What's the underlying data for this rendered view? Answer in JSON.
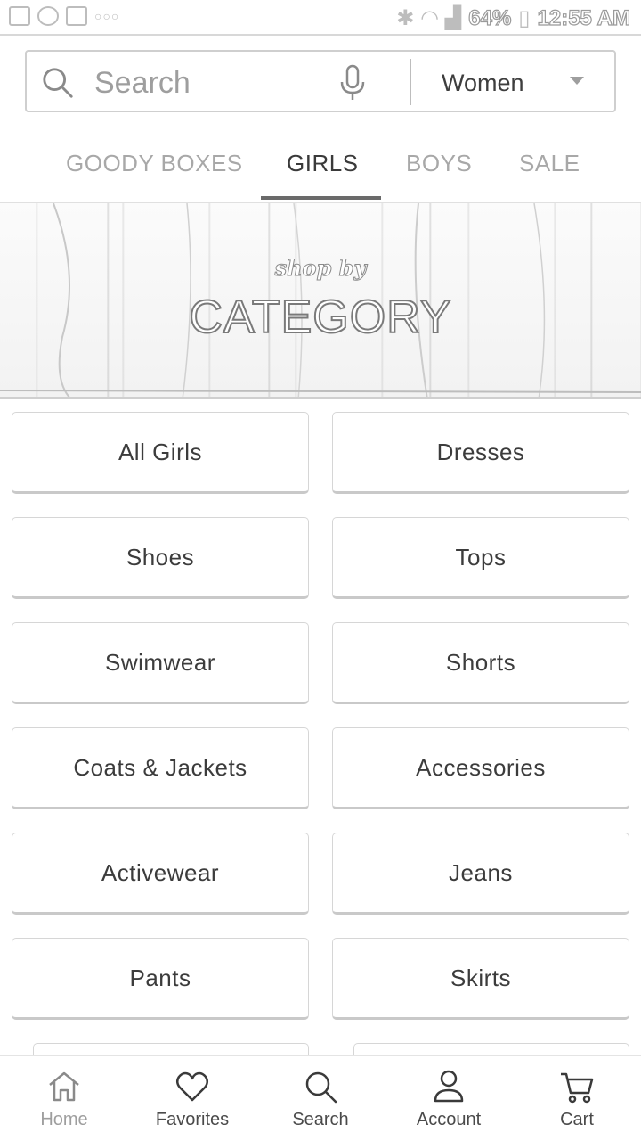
{
  "status_bar": {
    "battery": "64%",
    "time": "12:55 AM",
    "icons": [
      "photo-icon",
      "pinwheel-icon",
      "mail-icon",
      "voicemail-icon",
      "bluetooth-icon",
      "wifi-icon",
      "signal-icon",
      "battery-icon"
    ]
  },
  "search": {
    "placeholder": "Search",
    "department": "Women"
  },
  "tabs": [
    {
      "label": "GOODY BOXES",
      "active": false
    },
    {
      "label": "GIRLS",
      "active": true
    },
    {
      "label": "BOYS",
      "active": false
    },
    {
      "label": "SALE",
      "active": false
    }
  ],
  "banner": {
    "script": "shop by",
    "title": "CATEGORY"
  },
  "categories": [
    "All Girls",
    "Dresses",
    "Shoes",
    "Tops",
    "Swimwear",
    "Shorts",
    "Coats & Jackets",
    "Accessories",
    "Activewear",
    "Jeans",
    "Pants",
    "Skirts"
  ],
  "bottom_nav": [
    {
      "label": "Home",
      "icon": "home-icon",
      "active": false
    },
    {
      "label": "Favorites",
      "icon": "heart-icon",
      "active": true
    },
    {
      "label": "Search",
      "icon": "search-icon",
      "active": true
    },
    {
      "label": "Account",
      "icon": "account-icon",
      "active": true
    },
    {
      "label": "Cart",
      "icon": "cart-icon",
      "active": true
    }
  ],
  "colors": {
    "text_dark": "#3a3a3a",
    "text_muted": "#a8a8a8",
    "border": "#d6d6d6"
  }
}
